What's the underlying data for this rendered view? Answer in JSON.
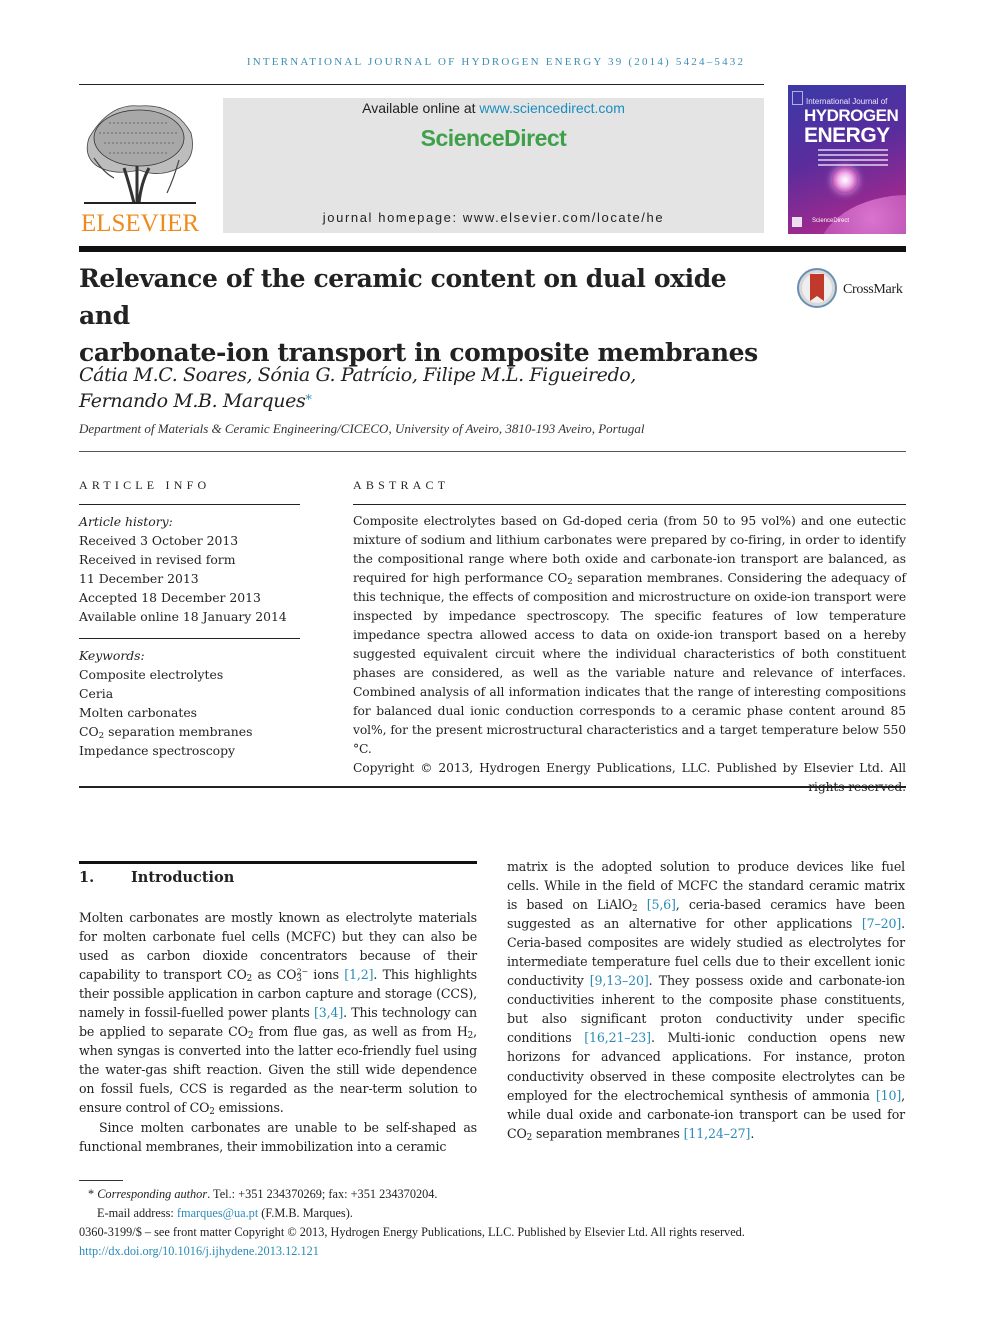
{
  "header": {
    "running_head": "INTERNATIONAL JOURNAL OF HYDROGEN ENERGY 39 (2014) 5424–5432",
    "publisher_logo_text": "ELSEVIER",
    "available_online_prefix": "Available online at ",
    "available_online_link": "www.sciencedirect.com",
    "sciencedirect_logo": "ScienceDirect",
    "journal_homepage": "journal homepage: www.elsevier.com/locate/he",
    "cover": {
      "line1": "International Journal of",
      "line2": "HYDROGEN",
      "line3": "ENERGY",
      "footer": "ScienceDirect"
    },
    "crossmark_label": "CrossMark"
  },
  "article": {
    "title_line1": "Relevance of the ceramic content on dual oxide and",
    "title_line2": "carbonate-ion transport in composite membranes",
    "authors_line1": "Cátia M.C. Soares, Sónia G. Patrício, Filipe M.L. Figueiredo,",
    "authors_line2": "Fernando M.B. Marques",
    "corresponding_mark": "*",
    "affiliation": "Department of Materials & Ceramic Engineering/CICECO, University of Aveiro, 3810-193 Aveiro, Portugal"
  },
  "article_info": {
    "heading": "ARTICLE INFO",
    "history_label": "Article history:",
    "history": [
      "Received 3 October 2013",
      "Received in revised form",
      "11 December 2013",
      "Accepted 18 December 2013",
      "Available online 18 January 2014"
    ],
    "keywords_label": "Keywords:",
    "keywords": [
      "Composite electrolytes",
      "Ceria",
      "Molten carbonates",
      "CO2 separation membranes",
      "Impedance spectroscopy"
    ]
  },
  "abstract": {
    "heading": "ABSTRACT",
    "p1": "Composite electrolytes based on Gd-doped ceria (from 50 to 95 vol%) and one eutectic mixture of sodium and lithium carbonates were prepared by co-firing, in order to identify the compositional range where both oxide and carbonate-ion transport are balanced, as required for high performance ",
    "p2": " separation membranes. Considering the adequacy of this technique, the effects of composition and microstructure on oxide-ion transport were inspected by impedance spectroscopy. The specific features of low temperature impedance spectra allowed access to data on oxide-ion transport based on a hereby suggested equivalent circuit where the individual characteristics of both constituent phases are considered, as well as the variable nature and relevance of interfaces. Combined analysis of all information indicates that the range of interesting compositions for balanced dual ionic conduction corresponds to a ceramic phase content around 85 vol%, for the present microstructural characteristics and a target temperature below 550 °C.",
    "copyright": "Copyright © 2013, Hydrogen Energy Publications, LLC. Published by Elsevier Ltd. All rights reserved."
  },
  "introduction": {
    "number": "1.",
    "title": "Introduction",
    "left": {
      "s1": "Molten carbonates are mostly known as electrolyte materials for molten carbonate fuel cells (MCFC) but they can also be used as carbon dioxide concentrators because of their capability to transport CO",
      "s2": " as CO",
      "s3": " ions ",
      "r1": "[1,2]",
      "s4": ". This highlights their possible application in carbon capture and storage (CCS), namely in fossil-fuelled power plants ",
      "r2": "[3,4]",
      "s5": ". This technology can be applied to separate CO",
      "s6": " from flue gas, as well as from H",
      "s7": ", when syngas is converted into the latter eco-friendly fuel using the water-gas shift reaction. Given the still wide dependence on fossil fuels, CCS is regarded as the near-term solution to ensure control of CO",
      "s8": " emissions.",
      "p2": "Since molten carbonates are unable to be self-shaped as functional membranes, their immobilization into a ceramic"
    },
    "right": {
      "s1": "matrix is the adopted solution to produce devices like fuel cells. While in the field of MCFC the standard ceramic matrix is based on LiAlO",
      "r1": "[5,6]",
      "s2": ", ceria-based ceramics have been suggested as an alternative for other applications ",
      "r2": "[7–20]",
      "s3": ". Ceria-based composites are widely studied as electrolytes for intermediate temperature fuel cells due to their excellent ionic conductivity ",
      "r3": "[9,13–20]",
      "s4": ". They possess oxide and carbonate-ion conductivities inherent to the composite phase constituents, but also significant proton conductivity under specific conditions ",
      "r4": "[16,21–23]",
      "s5": ". Multi-ionic conduction opens new horizons for advanced applications. For instance, proton conductivity observed in these composite electrolytes can be employed for the electrochemical synthesis of ammonia ",
      "r5": "[10]",
      "s6": ", while dual oxide and carbonate-ion transport can be used for CO",
      "s7": " separation membranes ",
      "r6": "[11,24–27]",
      "s8": "."
    }
  },
  "footnotes": {
    "star": "* ",
    "corresponding_label": "Corresponding author",
    "contact": ". Tel.: +351 234370269; fax: +351 234370204.",
    "email_label": "E-mail address: ",
    "email": "fmarques@ua.pt",
    "email_suffix": " (F.M.B. Marques).",
    "issn_line": "0360-3199/$ – see front matter Copyright © 2013, Hydrogen Energy Publications, LLC. Published by Elsevier Ltd. All rights reserved.",
    "doi": "http://dx.doi.org/10.1016/j.ijhydene.2013.12.121"
  },
  "chem": {
    "co2_base": "CO",
    "sub2": "2",
    "sub3": "3",
    "sup2minus": "2−",
    "h_base": "H"
  },
  "colors": {
    "link": "#2a8bb8",
    "running_head": "#3b8fb3",
    "elsevier_orange": "#f08a1c",
    "sciencedirect_green": "#3fa04a"
  }
}
